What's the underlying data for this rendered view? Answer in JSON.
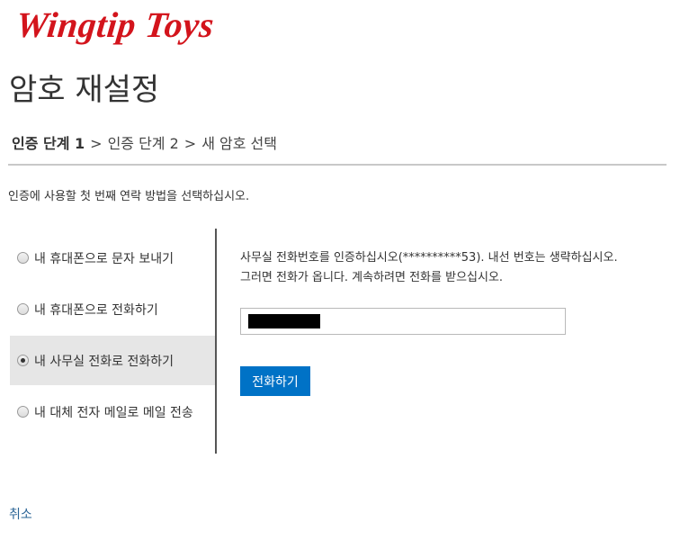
{
  "brand": {
    "logo_text": "Wingtip Toys",
    "logo_color": "#d3141c"
  },
  "page": {
    "title": "암호 재설정"
  },
  "breadcrumb": {
    "steps": [
      "인증 단계 1",
      "인증 단계 2",
      "새 암호 선택"
    ],
    "separator": ">",
    "current_index": 0
  },
  "instruction": "인증에 사용할 첫 번째 연락 방법을 선택하십시오.",
  "options": [
    {
      "label": "내 휴대폰으로 문자 보내기",
      "selected": false
    },
    {
      "label": "내 휴대폰으로 전화하기",
      "selected": false
    },
    {
      "label": "내 사무실 전화로 전화하기",
      "selected": true
    },
    {
      "label": "내 대체 전자 메일로 메일 전송",
      "selected": false
    }
  ],
  "detail": {
    "line1": "사무실 전화번호를 인증하십시오(**********53). 내선 번호는 생략하십시오.",
    "line2": "그러면 전화가 옵니다. 계속하려면 전화를 받으십시오.",
    "input_value": "",
    "button_label": "전화하기",
    "button_color": "#0072c6"
  },
  "cancel_label": "취소"
}
